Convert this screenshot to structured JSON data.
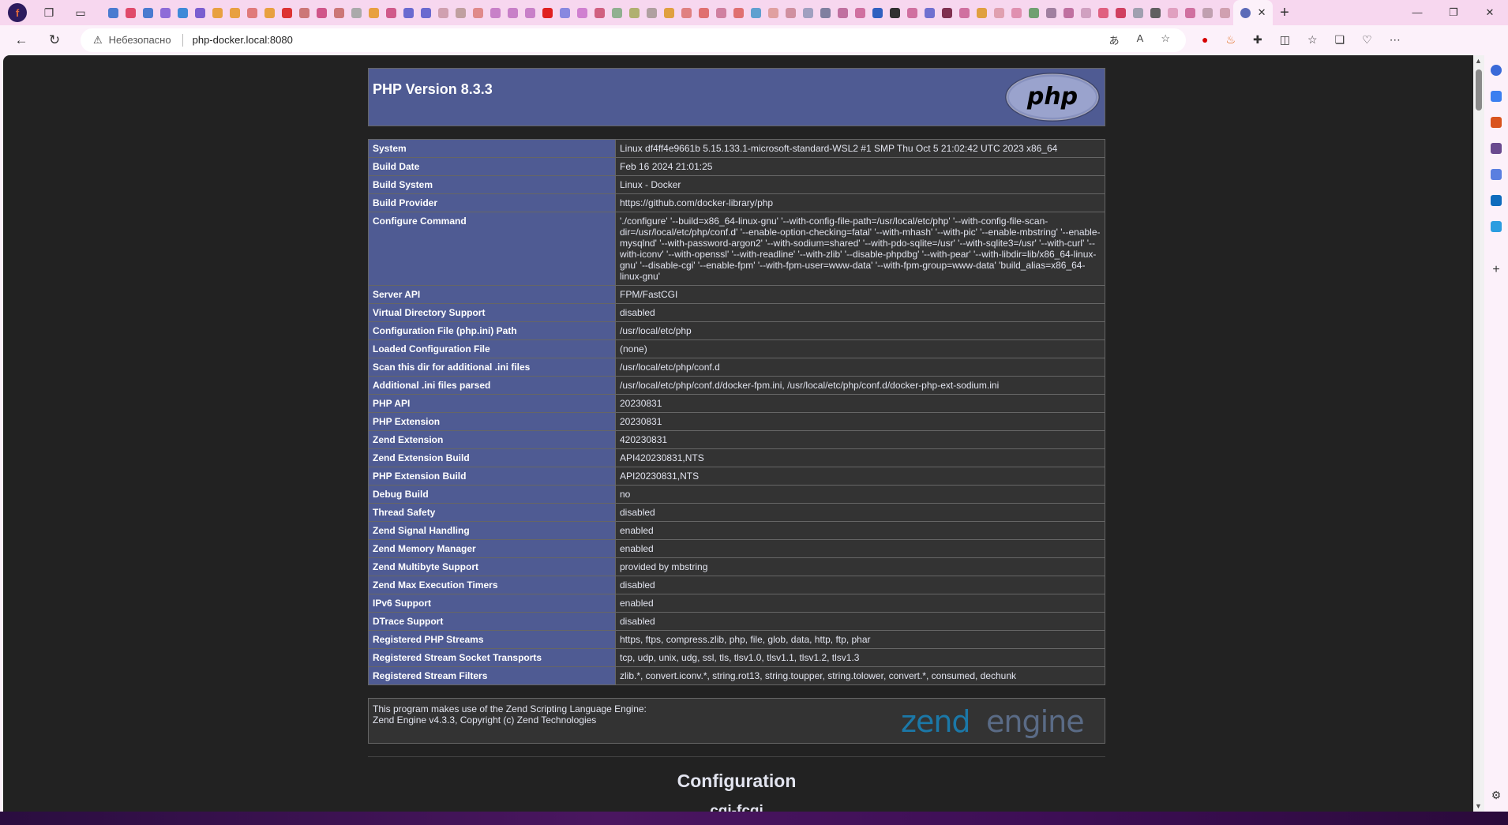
{
  "browser": {
    "tabs_strip": {
      "active_tab_close": "✕",
      "new_tab": "+"
    },
    "toolbar": {
      "security_label": "Небезопасно",
      "url": "php-docker.local:8080"
    }
  },
  "php": {
    "title": "PHP Version 8.3.3",
    "logo_text": "php",
    "rows": [
      {
        "key": "System",
        "value": "Linux df4ff4e9661b 5.15.133.1-microsoft-standard-WSL2 #1 SMP Thu Oct 5 21:02:42 UTC 2023 x86_64"
      },
      {
        "key": "Build Date",
        "value": "Feb 16 2024 21:01:25"
      },
      {
        "key": "Build System",
        "value": "Linux - Docker"
      },
      {
        "key": "Build Provider",
        "value": "https://github.com/docker-library/php"
      },
      {
        "key": "Configure Command",
        "value": "'./configure' '--build=x86_64-linux-gnu' '--with-config-file-path=/usr/local/etc/php' '--with-config-file-scan-dir=/usr/local/etc/php/conf.d' '--enable-option-checking=fatal' '--with-mhash' '--with-pic' '--enable-mbstring' '--enable-mysqlnd' '--with-password-argon2' '--with-sodium=shared' '--with-pdo-sqlite=/usr' '--with-sqlite3=/usr' '--with-curl' '--with-iconv' '--with-openssl' '--with-readline' '--with-zlib' '--disable-phpdbg' '--with-pear' '--with-libdir=lib/x86_64-linux-gnu' '--disable-cgi' '--enable-fpm' '--with-fpm-user=www-data' '--with-fpm-group=www-data' 'build_alias=x86_64-linux-gnu'"
      },
      {
        "key": "Server API",
        "value": "FPM/FastCGI"
      },
      {
        "key": "Virtual Directory Support",
        "value": "disabled"
      },
      {
        "key": "Configuration File (php.ini) Path",
        "value": "/usr/local/etc/php"
      },
      {
        "key": "Loaded Configuration File",
        "value": "(none)"
      },
      {
        "key": "Scan this dir for additional .ini files",
        "value": "/usr/local/etc/php/conf.d"
      },
      {
        "key": "Additional .ini files parsed",
        "value": "/usr/local/etc/php/conf.d/docker-fpm.ini, /usr/local/etc/php/conf.d/docker-php-ext-sodium.ini"
      },
      {
        "key": "PHP API",
        "value": "20230831"
      },
      {
        "key": "PHP Extension",
        "value": "20230831"
      },
      {
        "key": "Zend Extension",
        "value": "420230831"
      },
      {
        "key": "Zend Extension Build",
        "value": "API420230831,NTS"
      },
      {
        "key": "PHP Extension Build",
        "value": "API20230831,NTS"
      },
      {
        "key": "Debug Build",
        "value": "no"
      },
      {
        "key": "Thread Safety",
        "value": "disabled"
      },
      {
        "key": "Zend Signal Handling",
        "value": "enabled"
      },
      {
        "key": "Zend Memory Manager",
        "value": "enabled"
      },
      {
        "key": "Zend Multibyte Support",
        "value": "provided by mbstring"
      },
      {
        "key": "Zend Max Execution Timers",
        "value": "disabled"
      },
      {
        "key": "IPv6 Support",
        "value": "enabled"
      },
      {
        "key": "DTrace Support",
        "value": "disabled"
      },
      {
        "key": "Registered PHP Streams",
        "value": "https, ftps, compress.zlib, php, file, glob, data, http, ftp, phar"
      },
      {
        "key": "Registered Stream Socket Transports",
        "value": "tcp, udp, unix, udg, ssl, tls, tlsv1.0, tlsv1.1, tlsv1.2, tlsv1.3"
      },
      {
        "key": "Registered Stream Filters",
        "value": "zlib.*, convert.iconv.*, string.rot13, string.toupper, string.tolower, convert.*, consumed, dechunk"
      }
    ],
    "zend": {
      "line1": "This program makes use of the Zend Scripting Language Engine:",
      "line2": "Zend Engine v4.3.3, Copyright (c) Zend Technologies",
      "logo_word1": "zend",
      "logo_word2": "engine"
    },
    "configuration_title": "Configuration",
    "first_module": "cgi-fcgi"
  },
  "colors": {
    "php_header": "#4f5b93",
    "value_cell": "#333333",
    "page_bg": "#222222",
    "zend_logo": "#1b78a8"
  }
}
